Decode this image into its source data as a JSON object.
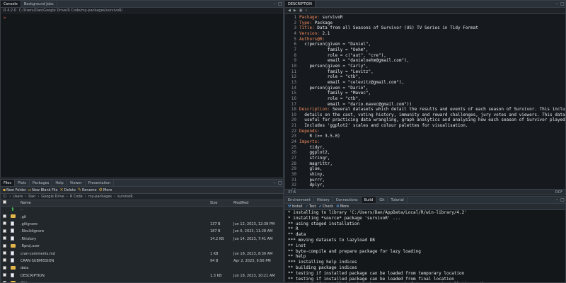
{
  "console": {
    "tabs": [
      "Console",
      "Background Jobs"
    ],
    "r_version": "R 4.2.0",
    "path": "C:/Users/Dan/Google Drive/R Code/my-packages/survivoR/",
    "prompt": ">"
  },
  "files": {
    "tabs": [
      "Files",
      "Plots",
      "Packages",
      "Help",
      "Viewer",
      "Presentation"
    ],
    "toolbar": [
      "New Folder",
      "New Blank File",
      "Delete",
      "Rename",
      "More"
    ],
    "breadcrumbs": [
      "C:",
      "Users",
      "Dan",
      "Google Drive",
      "R Code",
      "my-packages",
      "survivoR"
    ],
    "columns": {
      "name": "Name",
      "size": "Size",
      "modified": "Modified"
    },
    "up_label": "..",
    "rows": [
      {
        "name": ".git",
        "size": "",
        "modified": "",
        "type": "folder"
      },
      {
        "name": ".gitignore",
        "size": "137 B",
        "modified": "Jun 12, 2023, 12:38 PM",
        "type": "file"
      },
      {
        "name": ".Rbuildignore",
        "size": "187 B",
        "modified": "Jun 6, 2023, 11:28 AM",
        "type": "file"
      },
      {
        "name": ".Rhistory",
        "size": "14.2 KB",
        "modified": "Jun 14, 2023, 7:41 AM",
        "type": "file"
      },
      {
        "name": ".Rproj.user",
        "size": "",
        "modified": "",
        "type": "folder"
      },
      {
        "name": "cran-comments.md",
        "size": "1 KB",
        "modified": "Jun 18, 2023, 8:30 AM",
        "type": "file"
      },
      {
        "name": "CRAN-SUBMISSION",
        "size": "94 B",
        "modified": "Apr 2, 2023, 9:56 PM",
        "type": "file"
      },
      {
        "name": "data",
        "size": "",
        "modified": "",
        "type": "folder"
      },
      {
        "name": "DESCRIPTION",
        "size": "1.3 KB",
        "modified": "Jun 18, 2023, 10:21 AM",
        "type": "file"
      },
      {
        "name": "dev",
        "size": "",
        "modified": "",
        "type": "folder"
      }
    ]
  },
  "editor": {
    "tab": "DESCRIPTION",
    "lines": [
      {
        "n": "1",
        "k": "Package:",
        "t": " survivoR"
      },
      {
        "n": "2",
        "k": "Type:",
        "t": " Package"
      },
      {
        "n": "3",
        "k": "Title:",
        "t": " Data from all Seasons of Survivor (US) TV Series in Tidy Format"
      },
      {
        "n": "4",
        "k": "Version:",
        "t": " 2.1"
      },
      {
        "n": "5",
        "k": "Authors@R:",
        "t": ""
      },
      {
        "n": "6",
        "k": "",
        "t": "  c(person(given = \"Daniel\","
      },
      {
        "n": "7",
        "k": "",
        "t": "           family = \"Oehm\","
      },
      {
        "n": "8",
        "k": "",
        "t": "           role = c(\"aut\", \"cre\"),"
      },
      {
        "n": "9",
        "k": "",
        "t": "           email = \"danieloehm@gmail.com\"),"
      },
      {
        "n": "10",
        "k": "",
        "t": "    person(given = \"Carly\","
      },
      {
        "n": "11",
        "k": "",
        "t": "           family = \"Levitz\","
      },
      {
        "n": "12",
        "k": "",
        "t": "           role = \"ctb\","
      },
      {
        "n": "13",
        "k": "",
        "t": "           email = \"celevitz@gmail.com\"),"
      },
      {
        "n": "14",
        "k": "",
        "t": "    person(given = \"Dario\","
      },
      {
        "n": "15",
        "k": "",
        "t": "           family = \"Mavec\","
      },
      {
        "n": "16",
        "k": "",
        "t": "           role = \"ctb\","
      },
      {
        "n": "17",
        "k": "",
        "t": "           email = \"dario.mavec@gmail.com\"))"
      },
      {
        "n": "18",
        "k": "Description:",
        "t": " Several datasets which detail the results and events of each season of Survivor. This includes"
      },
      {
        "n": "19",
        "k": "",
        "t": "  details on the cast, voting history, immunity and reward challenges, jury votes and viewers. This data is"
      },
      {
        "n": "20",
        "k": "",
        "t": "  useful for practicing data wrangling, graph analytics and analysing how each season of Survivor played out."
      },
      {
        "n": "21",
        "k": "",
        "t": "  Includes 'ggplot2' scales and colour palettes for visualisation."
      },
      {
        "n": "22",
        "k": "Depends:",
        "t": ""
      },
      {
        "n": "23",
        "k": "",
        "t": "    R (>= 3.5.0)"
      },
      {
        "n": "24",
        "k": "Imports:",
        "t": ""
      },
      {
        "n": "25",
        "k": "",
        "t": "    tidyr,"
      },
      {
        "n": "26",
        "k": "",
        "t": "    ggplot2,"
      },
      {
        "n": "27",
        "k": "",
        "t": "    stringr,"
      },
      {
        "n": "28",
        "k": "",
        "t": "    magrittr,"
      },
      {
        "n": "29",
        "k": "",
        "t": "    glue,"
      },
      {
        "n": "30",
        "k": "",
        "t": "    shiny,"
      },
      {
        "n": "31",
        "k": "",
        "t": "    purrr,"
      },
      {
        "n": "32",
        "k": "",
        "t": "    dplyr,"
      },
      {
        "n": "33",
        "k": "",
        "t": "    crayon,"
      },
      {
        "n": "34",
        "k": "",
        "t": "    readr,"
      },
      {
        "n": "35",
        "k": "",
        "t": "    shinycssloaders,"
      },
      {
        "n": "36",
        "k": "",
        "t": "    lubridate,"
      },
      {
        "n": "37",
        "k": "",
        "t": ""
      }
    ],
    "status_left": "37:6",
    "status_right": "DCF"
  },
  "build": {
    "tabs": [
      "Environment",
      "History",
      "Connections",
      "Build",
      "Git",
      "Tutorial"
    ],
    "tools": [
      "Install",
      "Test",
      "Check",
      "More"
    ],
    "lines": [
      "* installing to library 'C:/Users/Dan/AppData/Local/R/win-library/4.2'",
      "* installing *source* package 'survivoR' ...",
      "** using staged installation",
      "** R",
      "** data",
      "*** moving datasets to lazyload DB",
      "** inst",
      "** byte-compile and prepare package for lazy loading",
      "** help",
      "*** installing help indices",
      "** building package indices",
      "** testing if installed package can be loaded from temporary location",
      "** testing if installed package can be loaded from final location",
      "** testing if installed package keeps a record of temporary installation path",
      "* DONE (survivoR)"
    ]
  },
  "colors": {
    "accent": "#f08a5d",
    "folder": "#e3b44a",
    "background": "#1e2226"
  }
}
